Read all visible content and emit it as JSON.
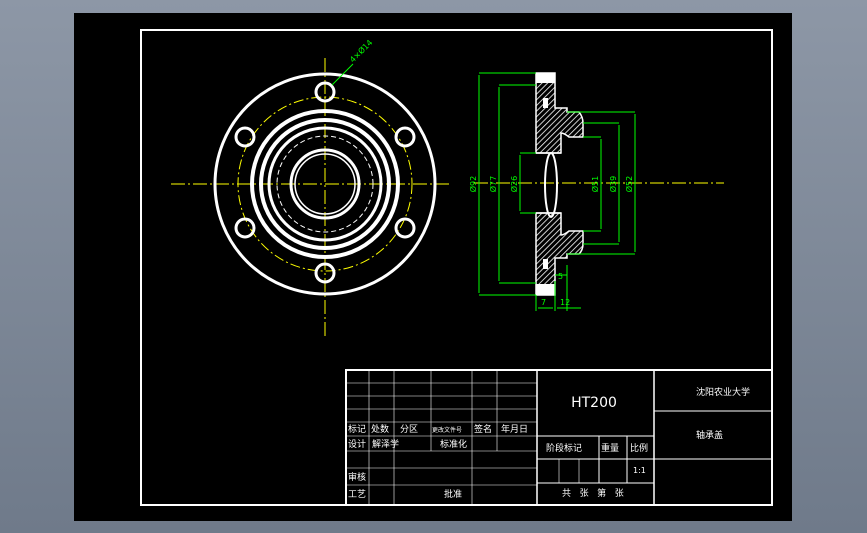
{
  "title_block": {
    "material": "HT200",
    "university": "沈阳农业大学",
    "part_name": "轴承盖",
    "scale": "1:1",
    "headers": [
      "标记",
      "处数",
      "分区",
      "更改文件号",
      "签名",
      "年月日"
    ],
    "row_design": [
      "设计",
      "解泽学",
      "标准化"
    ],
    "stage_labels": [
      "阶段标记",
      "重量",
      "比例"
    ],
    "row_review": "审核",
    "row_craft": [
      "工艺",
      "批准"
    ],
    "sheets_label": "共   张   第   张"
  },
  "dimensions": {
    "hole": "4×Ø14",
    "d1": "Ø92",
    "d2": "Ø77",
    "d3": "Ø26",
    "d4": "Ø51",
    "d5": "Ø39",
    "d6": "Ø52",
    "t1": "5",
    "t2": "7",
    "t3": "12"
  },
  "colors": {
    "frame": "#ffffff",
    "center_line": "#ffff00",
    "dimension": "#00ff00",
    "hatch": "#ffffff"
  }
}
